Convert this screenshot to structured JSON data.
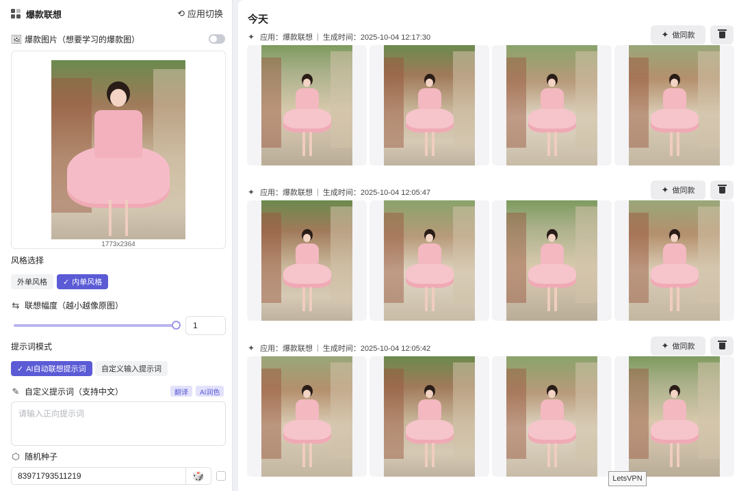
{
  "left": {
    "header": {
      "title": "爆款联想",
      "switch_label": "应用切换"
    },
    "viral_image": {
      "label": "爆款图片（想要学习的爆款图）",
      "size_text": "1773x2364",
      "toggle_on": false
    },
    "style": {
      "label": "风格选择",
      "options": [
        "外单风格",
        "内单风格"
      ],
      "selected": "内单风格"
    },
    "strength": {
      "label": "联想幅度（越小越像原图）",
      "value": "1",
      "fraction": 1.0
    },
    "prompt_mode": {
      "label": "提示词模式",
      "options": [
        "AI自动联想提示词",
        "自定义输入提示词"
      ],
      "selected": "AI自动联想提示词"
    },
    "custom_prompt": {
      "label": "自定义提示词（支持中文）",
      "translate": "翻译",
      "polish": "AI润色",
      "placeholder": "请输入正向提示词"
    },
    "seed": {
      "label": "随机种子",
      "value": "83971793511219"
    }
  },
  "right": {
    "section_title": "今天",
    "same_label": "做同款",
    "groups": [
      {
        "app": "应用：爆款联想",
        "time": "生成时间：2025-10-04 12:17:30"
      },
      {
        "app": "应用：爆款联想",
        "time": "生成时间：2025-10-04 12:05:47"
      },
      {
        "app": "应用：爆款联想",
        "time": "生成时间：2025-10-04 12:05:42"
      }
    ]
  },
  "watermark": "LetsVPN",
  "colors": {
    "accent": "#5b5bd6",
    "accent_light": "#e3e2fb",
    "dress_pink": "#f5bcc7"
  }
}
